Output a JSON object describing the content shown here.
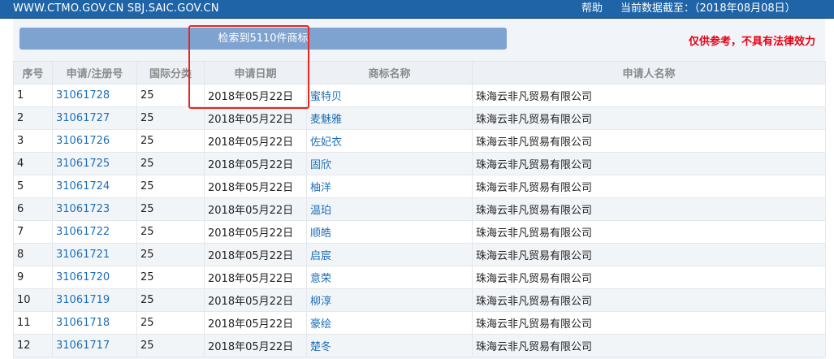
{
  "header": {
    "sites": "WWW.CTMO.GOV.CN SBJ.SAIC.GOV.CN",
    "help": "帮助",
    "as_of": "当前数据截至：（2018年08月08日）"
  },
  "result_summary": "检索到5110件商标",
  "disclaimer": "仅供参考，不具有法律效力",
  "table": {
    "headers": [
      "序号",
      "申请/注册号",
      "国际分类",
      "申请日期",
      "商标名称",
      "申请人名称"
    ],
    "rows": [
      {
        "no": "1",
        "reg": "31061728",
        "cls": "25",
        "date": "2018年05月22日",
        "mark": "蜜特贝",
        "applicant": "珠海云非凡贸易有限公司"
      },
      {
        "no": "2",
        "reg": "31061727",
        "cls": "25",
        "date": "2018年05月22日",
        "mark": "麦魅雅",
        "applicant": "珠海云非凡贸易有限公司"
      },
      {
        "no": "3",
        "reg": "31061726",
        "cls": "25",
        "date": "2018年05月22日",
        "mark": "佐妃衣",
        "applicant": "珠海云非凡贸易有限公司"
      },
      {
        "no": "4",
        "reg": "31061725",
        "cls": "25",
        "date": "2018年05月22日",
        "mark": "固欣",
        "applicant": "珠海云非凡贸易有限公司"
      },
      {
        "no": "5",
        "reg": "31061724",
        "cls": "25",
        "date": "2018年05月22日",
        "mark": "柚洋",
        "applicant": "珠海云非凡贸易有限公司"
      },
      {
        "no": "6",
        "reg": "31061723",
        "cls": "25",
        "date": "2018年05月22日",
        "mark": "温珀",
        "applicant": "珠海云非凡贸易有限公司"
      },
      {
        "no": "7",
        "reg": "31061722",
        "cls": "25",
        "date": "2018年05月22日",
        "mark": "顺皓",
        "applicant": "珠海云非凡贸易有限公司"
      },
      {
        "no": "8",
        "reg": "31061721",
        "cls": "25",
        "date": "2018年05月22日",
        "mark": "启宸",
        "applicant": "珠海云非凡贸易有限公司"
      },
      {
        "no": "9",
        "reg": "31061720",
        "cls": "25",
        "date": "2018年05月22日",
        "mark": "意荣",
        "applicant": "珠海云非凡贸易有限公司"
      },
      {
        "no": "10",
        "reg": "31061719",
        "cls": "25",
        "date": "2018年05月22日",
        "mark": "柳淳",
        "applicant": "珠海云非凡贸易有限公司"
      },
      {
        "no": "11",
        "reg": "31061718",
        "cls": "25",
        "date": "2018年05月22日",
        "mark": "豪绘",
        "applicant": "珠海云非凡贸易有限公司"
      },
      {
        "no": "12",
        "reg": "31061717",
        "cls": "25",
        "date": "2018年05月22日",
        "mark": "楚冬",
        "applicant": "珠海云非凡贸易有限公司"
      }
    ]
  },
  "colors": {
    "header_bar": "#1f64a7",
    "result_bar": "#7fa3d1",
    "link": "#1e6fb8",
    "disclaimer": "#e60012",
    "highlight_box": "#e8251f"
  }
}
